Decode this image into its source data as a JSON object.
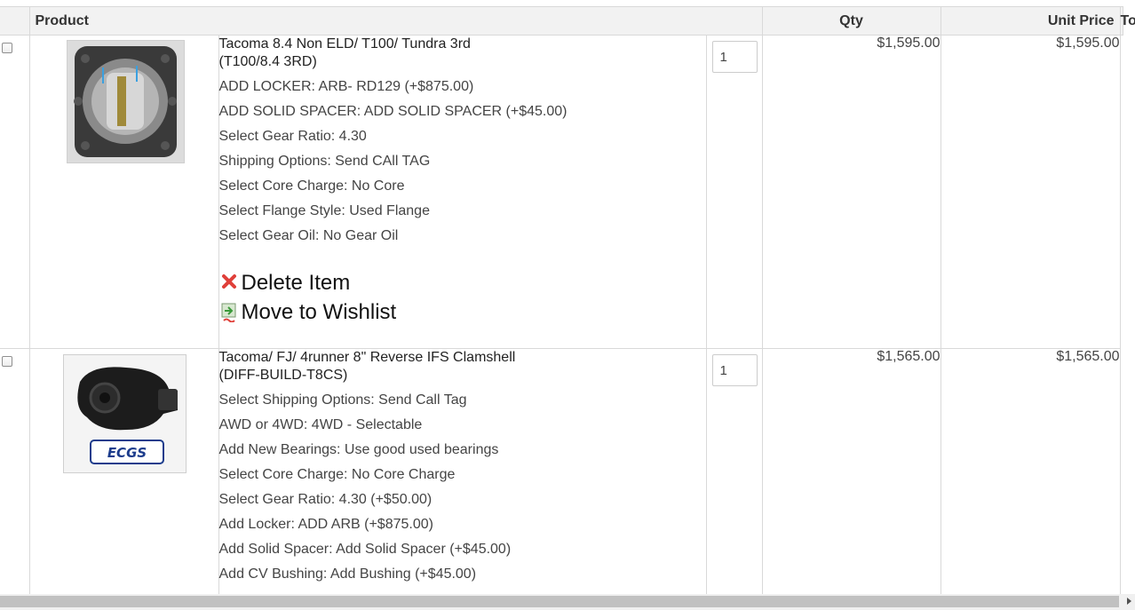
{
  "table": {
    "headers": {
      "product": "Product",
      "qty": "Qty",
      "unit_price": "Unit Price",
      "total": "Total"
    }
  },
  "items": [
    {
      "title_line1": "Tacoma 8.4 Non ELD/ T100/ Tundra 3rd",
      "title_line2": "(T100/8.4 3RD)",
      "options": [
        "ADD LOCKER: ARB- RD129 (+$875.00)",
        "ADD SOLID SPACER: ADD SOLID SPACER (+$45.00)",
        "Select Gear Ratio: 4.30",
        "Shipping Options: Send CAll TAG",
        "Select Core Charge: No Core",
        "Select Flange Style: Used Flange",
        "Select Gear Oil: No Gear Oil"
      ],
      "delete_label": "Delete Item",
      "wishlist_label": "Move to Wishlist",
      "qty": "1",
      "unit_price": "$1,595.00",
      "total": "$1,595.00"
    },
    {
      "title_line1": "Tacoma/ FJ/ 4runner 8\" Reverse IFS Clamshell",
      "title_line2": "(DIFF-BUILD-T8CS)",
      "options": [
        "Select Shipping Options: Send Call Tag",
        "AWD or 4WD: 4WD - Selectable",
        "Add New Bearings: Use good used bearings",
        "Select Core Charge: No Core Charge",
        "Select Gear Ratio: 4.30 (+$50.00)",
        "Add Locker: ADD ARB (+$875.00)",
        "Add Solid Spacer: Add Solid Spacer (+$45.00)",
        "Add CV Bushing: Add Bushing (+$45.00)"
      ],
      "qty": "1",
      "unit_price": "$1,565.00",
      "total": "$1,565.00"
    }
  ],
  "icons": {
    "delete": "close-icon",
    "wishlist": "wishlist-icon",
    "logo_text": "ECGS"
  },
  "colors": {
    "header_bg": "#f2f2f2",
    "border": "#d9d9d9",
    "delete_red": "#e0403a",
    "wishlist_green": "#4caf50"
  }
}
